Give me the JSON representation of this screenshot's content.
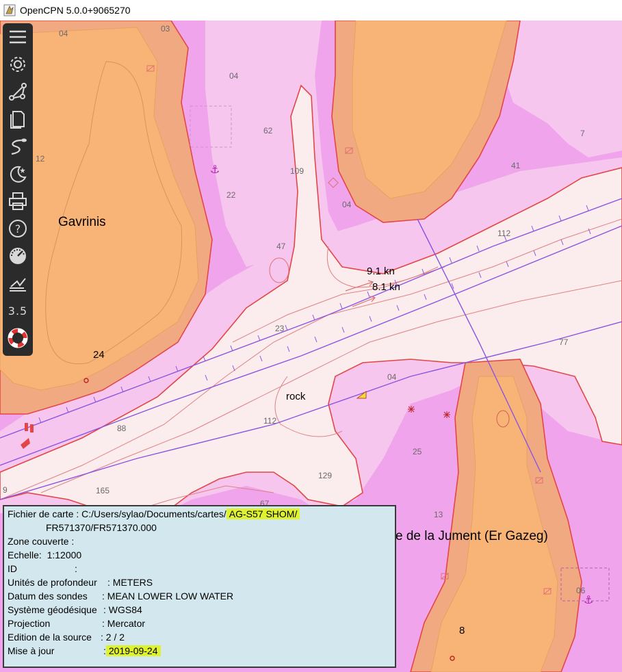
{
  "window": {
    "title": "OpenCPN 5.0.0+9065270"
  },
  "toolbar": {
    "items": [
      {
        "name": "menu-icon"
      },
      {
        "name": "gear-icon"
      },
      {
        "name": "route-icon"
      },
      {
        "name": "documents-icon"
      },
      {
        "name": "track-icon"
      },
      {
        "name": "night-mode-icon"
      },
      {
        "name": "print-icon"
      },
      {
        "name": "help-icon"
      },
      {
        "name": "dashboard-icon"
      },
      {
        "name": "ais-icon"
      },
      {
        "name": "scale-icon",
        "label": "3.5"
      },
      {
        "name": "lifebuoy-icon"
      }
    ]
  },
  "chart": {
    "place_names": {
      "gavrinis": "Gavrinis",
      "jument": "e de la Jument (Er Gazeg)",
      "rock": "rock"
    },
    "currents": {
      "speed1": "9.1 kn",
      "speed2": "8.1 kn"
    },
    "heights": {
      "h24": "24",
      "h8": "8"
    },
    "soundings": {
      "s01": "04",
      "s02": "03",
      "s03": "04",
      "s04": "62",
      "s05": "12",
      "s06": "22",
      "s07": "109",
      "s08": "04",
      "s09": "47",
      "s10": "7",
      "s11": "41",
      "s12": "112",
      "s13": "23",
      "s14": "77",
      "s15": "04",
      "s16": "88",
      "s17": "112",
      "s18": "25",
      "s19": "129",
      "s20": "165",
      "s21": "9",
      "s22": "13",
      "s23": "06",
      "s24": "67"
    }
  },
  "info": {
    "file_label": "Fichier de carte :",
    "file_path_prefix": "C:/Users/sylao/Documents/cartes/",
    "file_path_highlight": "AG-S57 SHOM/",
    "file_path_second": "FR571370/FR571370.000",
    "zone_label": "Zone couverte",
    "zone_sep": ":",
    "scale_label": "Echelle:",
    "scale_value": "1:12000",
    "id_label": "ID",
    "id_sep": ":",
    "depth_units_label": "Unités de profondeur",
    "depth_units_value": ": METERS",
    "datum_label": "Datum des sondes",
    "datum_value": ": MEAN LOWER LOW WATER",
    "geodetic_label": "Système géodésique",
    "geodetic_value": ": WGS84",
    "projection_label": "Projection",
    "projection_value": ": Mercator",
    "edition_label": "Edition de la source",
    "edition_value": ": 2 / 2",
    "update_label": "Mise à jour",
    "update_sep": ":",
    "update_value": "2019-09-24"
  },
  "colors": {
    "deep_water": "#fbecee",
    "mid_water": "#f6c6ee",
    "shallow_water": "#f0a4ec",
    "foreshore": "#f1a982",
    "land": "#f8b476",
    "coastline": "#e24646",
    "fairway": "#8a55e0",
    "panel_bg": "#d3e8ee",
    "highlight": "#dff230",
    "toolbar_bg": "#2b2b2b"
  }
}
